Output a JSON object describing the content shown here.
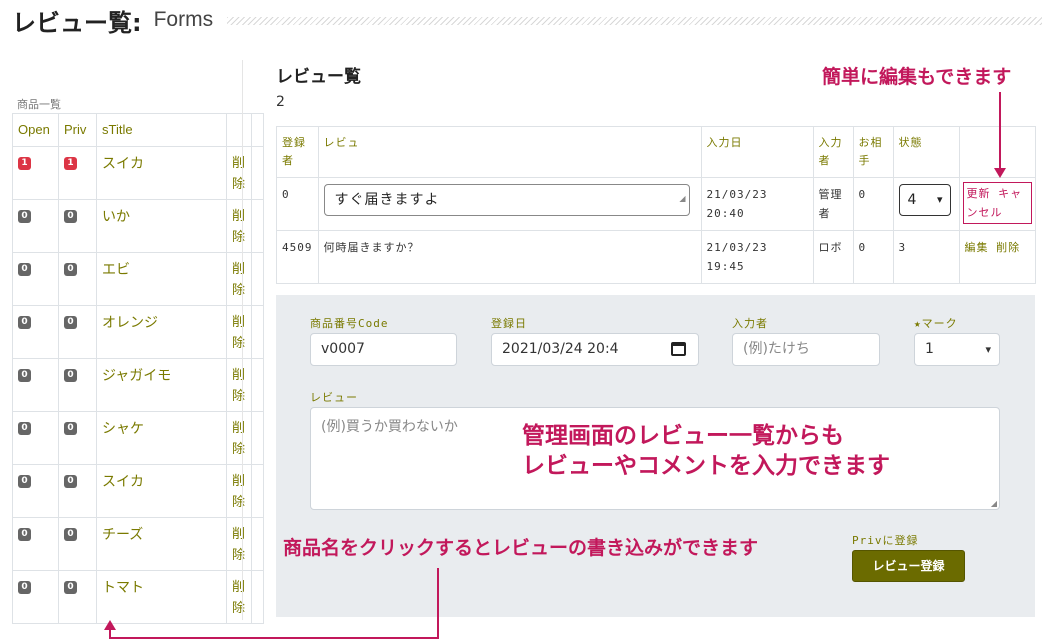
{
  "header": {
    "title": "レビュー覧:",
    "subtitle": "Forms"
  },
  "products": {
    "caption": "商品一覧",
    "columns": [
      "Open",
      "Priv",
      "sTitle"
    ],
    "delete_label": "削除",
    "rows": [
      {
        "open": "1",
        "priv": "1",
        "title": "スイカ"
      },
      {
        "open": "0",
        "priv": "0",
        "title": "いか"
      },
      {
        "open": "0",
        "priv": "0",
        "title": "エビ"
      },
      {
        "open": "0",
        "priv": "0",
        "title": "オレンジ"
      },
      {
        "open": "0",
        "priv": "0",
        "title": "ジャガイモ"
      },
      {
        "open": "0",
        "priv": "0",
        "title": "シャケ"
      },
      {
        "open": "0",
        "priv": "0",
        "title": "スイカ"
      },
      {
        "open": "0",
        "priv": "0",
        "title": "チーズ"
      },
      {
        "open": "0",
        "priv": "0",
        "title": "トマト"
      }
    ]
  },
  "reviews": {
    "title": "レビュー覧",
    "count": "2",
    "columns": [
      "登録者",
      "レビュ",
      "入力日",
      "入力者",
      "お相手",
      "状態",
      ""
    ],
    "rows": [
      {
        "id": "0",
        "text": "すぐ届きますよ",
        "date1": "21/03/23",
        "date2": "20:40",
        "author": "管理者",
        "partner": "0",
        "status": "4",
        "action1": "更新",
        "action2": "キャンセル"
      },
      {
        "id": "4509",
        "text": "何時届きますか？",
        "date1": "21/03/23",
        "date2": "19:45",
        "author": "ロボ",
        "partner": "0",
        "status": "3",
        "action1": "編集",
        "action2": "削除"
      }
    ]
  },
  "form": {
    "code_label": "商品番号Code",
    "code_value": "v0007",
    "date_label": "登録日",
    "date_value": "2021/03/24 20:4",
    "author_label": "入力者",
    "author_placeholder": "(例)たけち",
    "mark_label": "★マーク",
    "mark_value": "1",
    "review_label": "レビュー",
    "review_placeholder": "(例)買うか買わないか",
    "priv_label": "Privに登録",
    "submit_label": "レビュー登録"
  },
  "annotations": {
    "edit_note": "簡単に編集もできます",
    "admin_note_line1": "管理画面のレビュー一覧からも",
    "admin_note_line2": "レビューやコメントを入力できます",
    "click_note": "商品名をクリックするとレビューの書き込みができます"
  },
  "colors": {
    "accent": "#c2185b",
    "olive": "#7a7a00",
    "button": "#6b6b00",
    "badge_red": "#dc3545",
    "badge_gray": "#666666",
    "panel": "#e9ecef"
  }
}
